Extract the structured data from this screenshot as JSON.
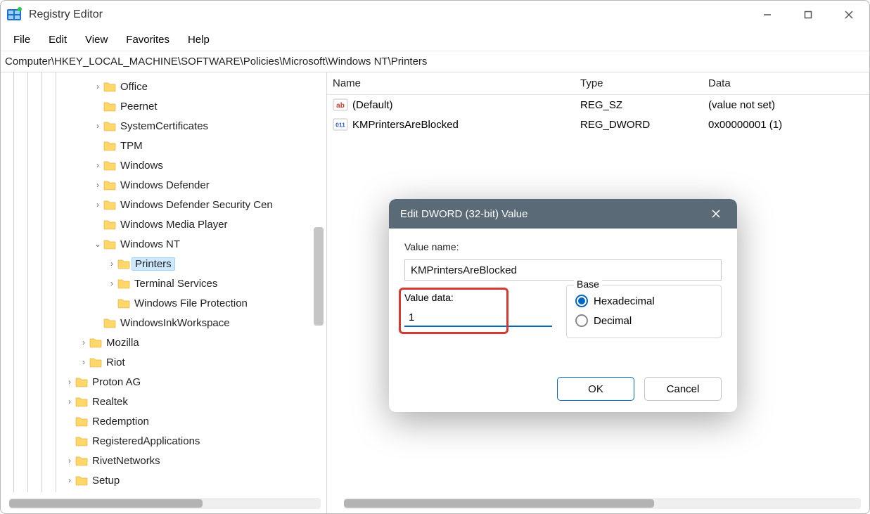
{
  "window": {
    "title": "Registry Editor"
  },
  "menu": {
    "file": "File",
    "edit": "Edit",
    "view": "View",
    "favorites": "Favorites",
    "help": "Help"
  },
  "address": "Computer\\HKEY_LOCAL_MACHINE\\SOFTWARE\\Policies\\Microsoft\\Windows NT\\Printers",
  "tree": {
    "items": [
      {
        "label": "Office",
        "depth": 6,
        "expandable": true
      },
      {
        "label": "Peernet",
        "depth": 6,
        "expandable": false
      },
      {
        "label": "SystemCertificates",
        "depth": 6,
        "expandable": true
      },
      {
        "label": "TPM",
        "depth": 6,
        "expandable": false
      },
      {
        "label": "Windows",
        "depth": 6,
        "expandable": true
      },
      {
        "label": "Windows Defender",
        "depth": 6,
        "expandable": true
      },
      {
        "label": "Windows Defender Security Cen",
        "depth": 6,
        "expandable": true
      },
      {
        "label": "Windows Media Player",
        "depth": 6,
        "expandable": false
      },
      {
        "label": "Windows NT",
        "depth": 6,
        "expandable": true,
        "expanded": true
      },
      {
        "label": "Printers",
        "depth": 7,
        "expandable": true,
        "selected": true
      },
      {
        "label": "Terminal Services",
        "depth": 7,
        "expandable": true
      },
      {
        "label": "Windows File Protection",
        "depth": 7,
        "expandable": false
      },
      {
        "label": "WindowsInkWorkspace",
        "depth": 6,
        "expandable": false
      },
      {
        "label": "Mozilla",
        "depth": 5,
        "expandable": true
      },
      {
        "label": "Riot",
        "depth": 5,
        "expandable": true
      },
      {
        "label": "Proton AG",
        "depth": 4,
        "expandable": true
      },
      {
        "label": "Realtek",
        "depth": 4,
        "expandable": true
      },
      {
        "label": "Redemption",
        "depth": 4,
        "expandable": false
      },
      {
        "label": "RegisteredApplications",
        "depth": 4,
        "expandable": false
      },
      {
        "label": "RivetNetworks",
        "depth": 4,
        "expandable": true
      },
      {
        "label": "Setup",
        "depth": 4,
        "expandable": true
      }
    ]
  },
  "list": {
    "columns": {
      "name": "Name",
      "type": "Type",
      "data": "Data"
    },
    "rows": [
      {
        "name": "(Default)",
        "type": "REG_SZ",
        "data": "(value not set)",
        "icon": "sz"
      },
      {
        "name": "KMPrintersAreBlocked",
        "type": "REG_DWORD",
        "data": "0x00000001 (1)",
        "icon": "dword"
      }
    ]
  },
  "dialog": {
    "title": "Edit DWORD (32-bit) Value",
    "value_name_label": "Value name:",
    "value_name": "KMPrintersAreBlocked",
    "value_data_label": "Value data:",
    "value_data": "1",
    "base_label": "Base",
    "hex_label": "Hexadecimal",
    "dec_label": "Decimal",
    "base_selected": "hex",
    "ok": "OK",
    "cancel": "Cancel"
  }
}
